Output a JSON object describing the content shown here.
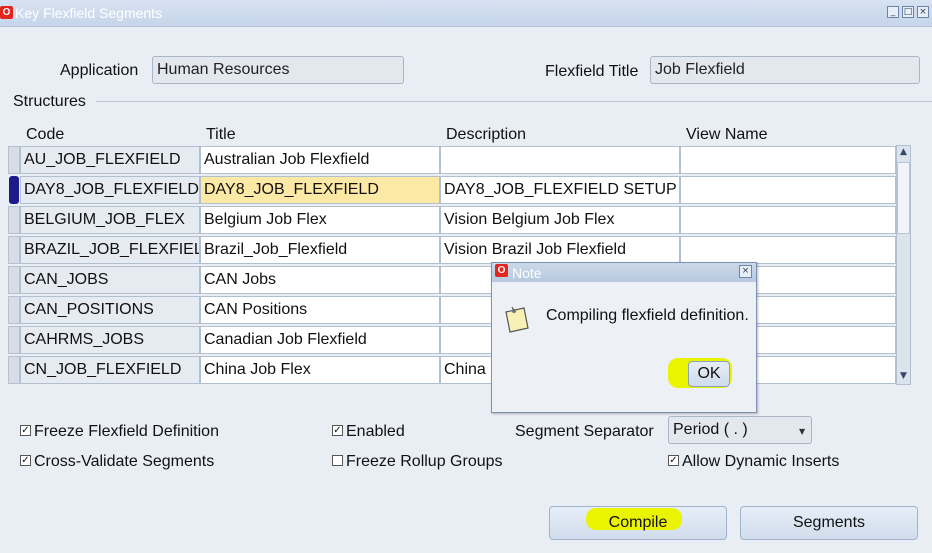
{
  "window": {
    "title": "Key Flexfield Segments",
    "buttons": [
      "_",
      "□",
      "×"
    ]
  },
  "header": {
    "application_label": "Application",
    "application_value": "Human Resources",
    "flexfield_title_label": "Flexfield Title",
    "flexfield_title_value": "Job Flexfield"
  },
  "structures": {
    "label": "Structures",
    "columns": [
      "Code",
      "Title",
      "Description",
      "View Name"
    ],
    "rows": [
      {
        "code": "AU_JOB_FLEXFIELD",
        "title": "Australian Job Flexfield",
        "description": "",
        "view": ""
      },
      {
        "code": "DAY8_JOB_FLEXFIELD",
        "title": "DAY8_JOB_FLEXFIELD",
        "description": "DAY8_JOB_FLEXFIELD SETUP",
        "view": ""
      },
      {
        "code": "BELGIUM_JOB_FLEX",
        "title": "Belgium Job Flex",
        "description": "Vision Belgium Job Flex",
        "view": ""
      },
      {
        "code": "BRAZIL_JOB_FLEXFIELD",
        "title": "Brazil_Job_Flexfield",
        "description": "Vision Brazil Job Flexfield",
        "view": ""
      },
      {
        "code": "CAN_JOBS",
        "title": "CAN Jobs",
        "description": "",
        "view": ""
      },
      {
        "code": "CAN_POSITIONS",
        "title": "CAN Positions",
        "description": "",
        "view": ""
      },
      {
        "code": "CAHRMS_JOBS",
        "title": "Canadian Job Flexfield",
        "description": "",
        "view": ""
      },
      {
        "code": "CN_JOB_FLEXFIELD",
        "title": "China Job Flex",
        "description": "China",
        "view": ""
      }
    ]
  },
  "options": {
    "freeze_definition": {
      "label": "Freeze Flexfield Definition",
      "checked": true
    },
    "cross_validate": {
      "label": "Cross-Validate Segments",
      "checked": true
    },
    "enabled": {
      "label": "Enabled",
      "checked": true
    },
    "freeze_rollup": {
      "label": "Freeze Rollup Groups",
      "checked": false
    },
    "allow_dynamic": {
      "label": "Allow Dynamic Inserts",
      "checked": true
    },
    "separator_label": "Segment Separator",
    "separator_value": "Period ( . )"
  },
  "buttons": {
    "compile": "Compile",
    "segments": "Segments"
  },
  "dialog": {
    "title": "Note",
    "message": "Compiling flexfield definition.",
    "ok": "OK",
    "close": "×"
  },
  "colors": {
    "highlight": "#eaf300",
    "selected_cell": "#fde9a6",
    "oracle_red": "#e2251d"
  }
}
